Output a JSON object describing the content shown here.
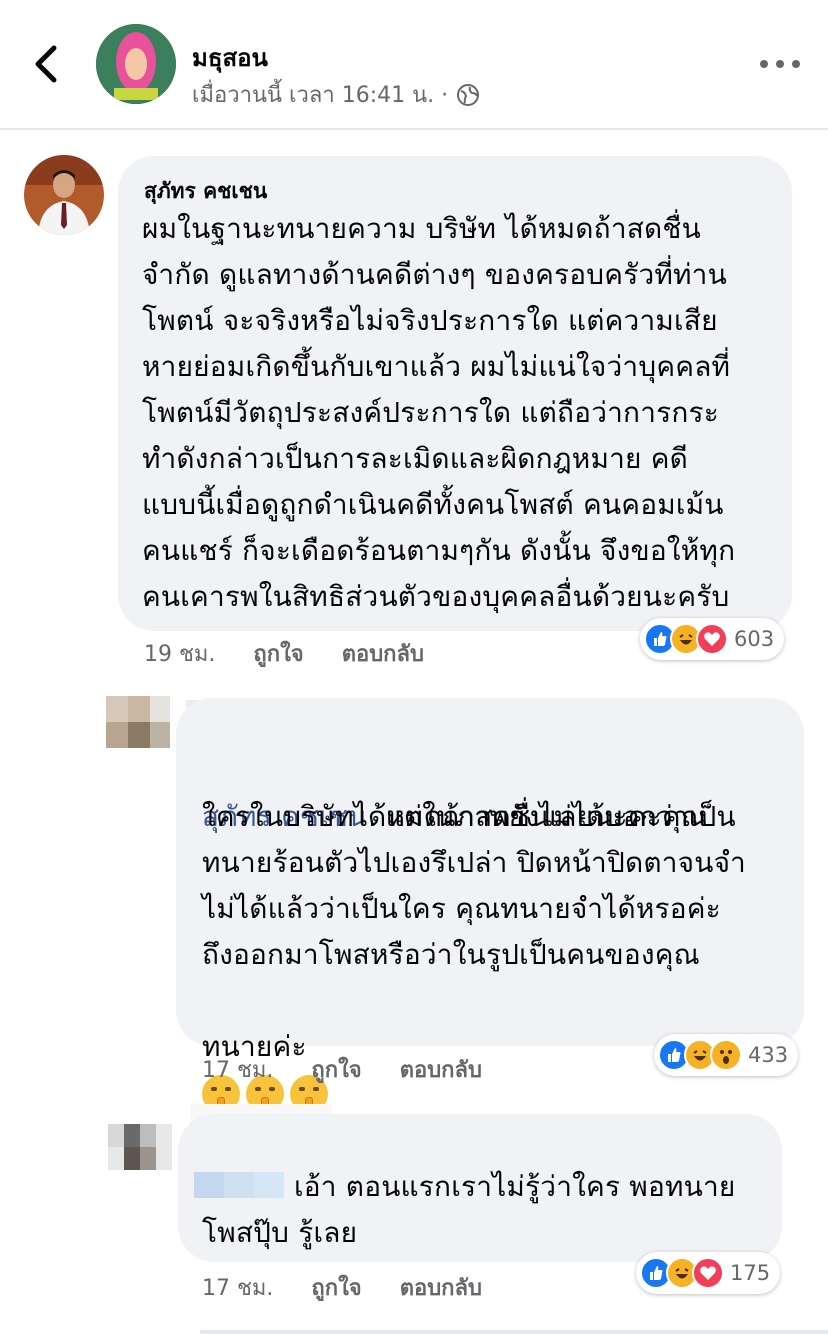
{
  "header": {
    "page_name": "มธุสอน",
    "meta": "เมื่อวานนี้ เวลา 16:41 น. ·",
    "icons": {
      "back": "chevron-left-icon",
      "privacy": "globe-icon",
      "more": "more-dots-icon"
    }
  },
  "comments": [
    {
      "author": "สุภัทร คชเชน",
      "text": "ผมในฐานะทนายความ บริษัท ได้หมดถ้าสดชื่น\nจำกัด ดูแลทางด้านคดีต่างๆ ของครอบครัวที่ท่าน\nโพตน์ จะจริงหรือไม่จริงประการใด แต่ความเสีย\nหายย่อมเกิดขึ้นกับเขาแล้ว ผมไม่แน่ใจว่าบุคคลที่\nโพตน์มีวัตถุประสงค์ประการใด แต่ถือว่าการกระ\nทำดังกล่าวเป็นการละเมิดและผิดกฎหมาย คดี\nแบบนี้เมื่อดูถูกดำเนินคดีทั้งคนโพสต์ คนคอมเม้น\nคนแชร์ ก็จะเดือดร้อนตามๆกัน ดังนั้น จึงขอให้ทุก\nคนเคารพในสิทธิส่วนตัวของบุคคลอื่นด้วยนะครับ",
      "time": "19 ชม.",
      "like": "ถูกใจ",
      "reply": "ตอบกลับ",
      "reaction_count": "603",
      "reactions": [
        "like",
        "haha",
        "love"
      ]
    },
    {
      "mention": "สุภัทร คชเชน",
      "text_first": "แต่ในภาพยังไม่ได้บอกว่าเป็น",
      "text": "ใครในบริษัทได้หมดถ้าสดชื่นเลยนะคะคุณ\nทนายร้อนตัวไปเองรึเปล่า ปิดหน้าปิดตาจนจำ\nไม่ได้แล้วว่าเป็นใคร คุณทนายจำได้หรอค่ะ\nถึงออกมาโพสหรือว่าในรูปเป็นคนของคุณ",
      "text_last": "ทนายค่ะ",
      "emoji": [
        "shushing-face-icon",
        "shushing-face-icon",
        "shushing-face-icon"
      ],
      "time": "17 ชม.",
      "like": "ถูกใจ",
      "reply": "ตอบกลับ",
      "reaction_count": "433",
      "reactions": [
        "like",
        "haha",
        "wow"
      ]
    },
    {
      "text": "เอ้า ตอนแรกเราไม่รู้ว่าใคร พอทนาย\nโพสปุ๊บ รู้เลย",
      "time": "17 ชม.",
      "like": "ถูกใจ",
      "reply": "ตอบกลับ",
      "reaction_count": "175",
      "reactions": [
        "like",
        "haha",
        "love"
      ]
    }
  ],
  "colors": {
    "bubble": "#f0f2f5",
    "mention": "#385898",
    "meta": "#65676b",
    "like": "#1877f2",
    "love": "#f33e58",
    "haha": "#f7b125"
  }
}
